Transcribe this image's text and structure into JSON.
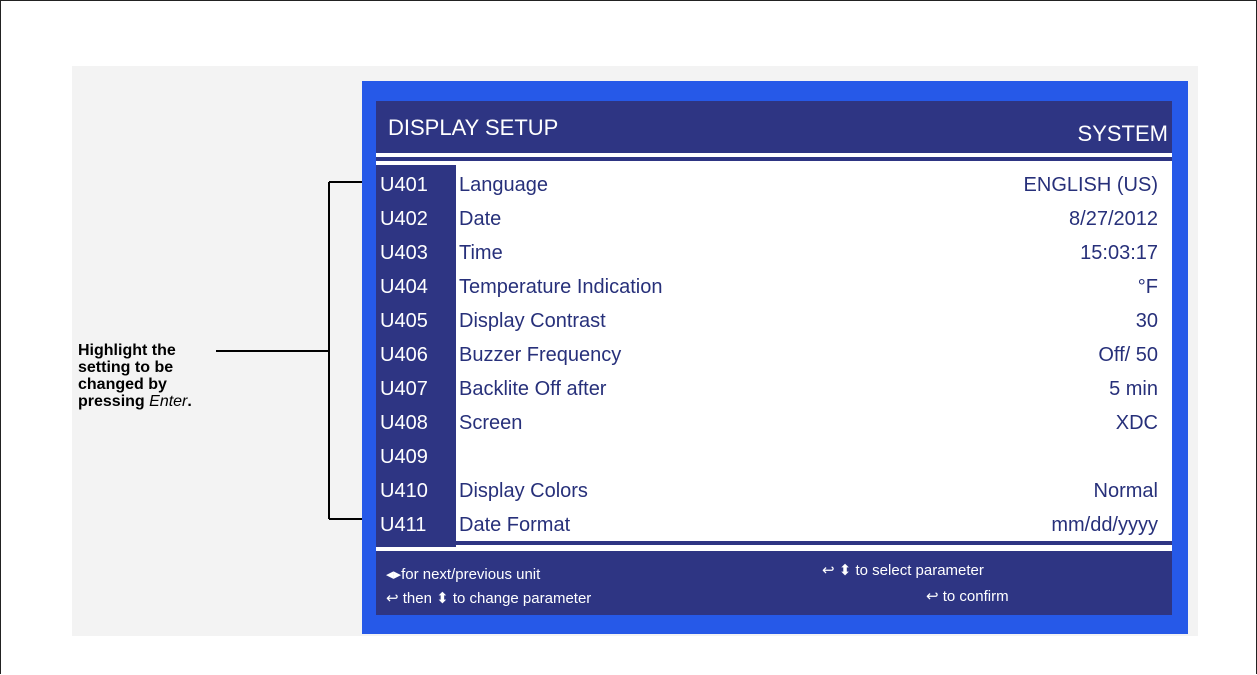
{
  "annotation": {
    "text_line1": "Highlight the",
    "text_line2": "setting to be",
    "text_line3": "changed by",
    "text_line4": "pressing ",
    "text_italic": "Enter",
    "text_period": "."
  },
  "screen": {
    "title": "DISPLAY SETUP",
    "context": "SYSTEM",
    "rows": [
      {
        "code": "U401",
        "label": "Language",
        "value": "ENGLISH (US)"
      },
      {
        "code": "U402",
        "label": "Date",
        "value": "8/27/2012"
      },
      {
        "code": "U403",
        "label": "Time",
        "value": "15:03:17"
      },
      {
        "code": "U404",
        "label": "Temperature Indication",
        "value": "°F"
      },
      {
        "code": "U405",
        "label": "Display Contrast",
        "value": "30"
      },
      {
        "code": "U406",
        "label": "Buzzer Frequency",
        "value": "Off/ 50"
      },
      {
        "code": "U407",
        "label": "Backlite Off after",
        "value": "5 min"
      },
      {
        "code": "U408",
        "label": "Screen",
        "value": "XDC"
      },
      {
        "code": "U409",
        "label": "",
        "value": ""
      },
      {
        "code": "U410",
        "label": "Display Colors",
        "value": "Normal"
      },
      {
        "code": "U411",
        "label": "Date Format",
        "value": "mm/dd/yyyy"
      }
    ],
    "footer": {
      "hint_next_prev": "for next/previous unit",
      "hint_then": "then",
      "hint_change": "to change parameter",
      "hint_select": "to select parameter",
      "hint_confirm": "to confirm"
    }
  },
  "colors": {
    "outer_blue": "#2659e8",
    "dark_navy": "#2e3583",
    "text_navy": "#27307a"
  },
  "icons": {
    "left_right_arrows": "left-right-arrows-icon",
    "enter_return": "enter-return-icon",
    "up_down_arrows": "up-down-arrows-icon"
  }
}
